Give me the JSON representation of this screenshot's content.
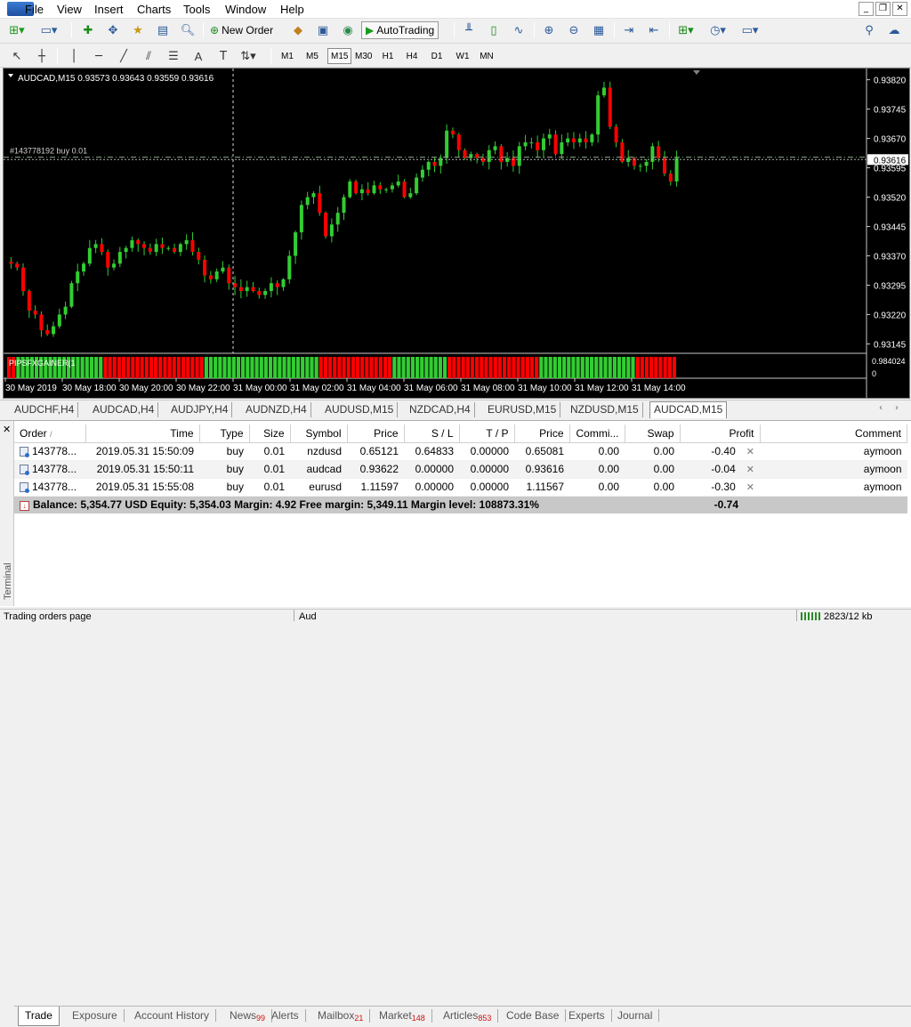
{
  "menu": [
    "File",
    "View",
    "Insert",
    "Charts",
    "Tools",
    "Window",
    "Help"
  ],
  "toolbar": {
    "new_order": "New Order",
    "autotrading": "AutoTrading",
    "timeframes": [
      "M1",
      "M5",
      "M15",
      "M30",
      "H1",
      "H4",
      "D1",
      "W1",
      "MN"
    ],
    "active_timeframe": "M15"
  },
  "chart": {
    "header": "AUDCAD,M15  0.93573 0.93643 0.93559 0.93616",
    "order_line_label": "#143778192 buy 0.01",
    "current_price_label": "0.93616",
    "indicator_label": "PIPSFXGAINER(1",
    "indicator_scale_top": "0.984024",
    "indicator_scale_bottom": "0",
    "bg_color": "#000000",
    "bull_color": "#32cd32",
    "bear_color": "#ff0000",
    "price_axis_labels": [
      "0.93820",
      "0.93745",
      "0.93670",
      "0.93595",
      "0.93520",
      "0.93445",
      "0.93370",
      "0.93295",
      "0.93220",
      "0.93145"
    ],
    "time_axis_labels": [
      "30 May 2019",
      "30 May 18:00",
      "30 May 20:00",
      "30 May 22:00",
      "31 May 00:00",
      "31 May 02:00",
      "31 May 04:00",
      "31 May 06:00",
      "31 May 08:00",
      "31 May 10:00",
      "31 May 12:00",
      "31 May 14:00"
    ]
  },
  "chart_data": {
    "type": "candlestick",
    "symbol": "AUDCAD",
    "timeframe": "M15",
    "ylim": [
      0.9313,
      0.93835
    ],
    "grid": false,
    "candles_close": [
      0.9335,
      0.9334,
      0.9328,
      0.9323,
      0.9322,
      0.9318,
      0.9317,
      0.9319,
      0.9322,
      0.9324,
      0.933,
      0.9333,
      0.9335,
      0.9339,
      0.934,
      0.9338,
      0.9334,
      0.9335,
      0.9338,
      0.9339,
      0.9341,
      0.934,
      0.9339,
      0.9338,
      0.934,
      0.9339,
      0.9339,
      0.9338,
      0.934,
      0.9341,
      0.9338,
      0.9336,
      0.9332,
      0.9331,
      0.9333,
      0.9334,
      0.933,
      0.9329,
      0.9328,
      0.9329,
      0.9328,
      0.9327,
      0.9328,
      0.933,
      0.9329,
      0.9331,
      0.9337,
      0.9343,
      0.935,
      0.9352,
      0.9353,
      0.9348,
      0.9342,
      0.9345,
      0.9348,
      0.9352,
      0.9356,
      0.9353,
      0.9354,
      0.9353,
      0.9355,
      0.9354,
      0.9354,
      0.9355,
      0.9356,
      0.9352,
      0.9353,
      0.9357,
      0.9359,
      0.9361,
      0.936,
      0.9362,
      0.9369,
      0.9368,
      0.9364,
      0.9362,
      0.9363,
      0.9362,
      0.9361,
      0.9364,
      0.9365,
      0.9361,
      0.9362,
      0.936,
      0.9365,
      0.9366,
      0.9366,
      0.9364,
      0.9367,
      0.9368,
      0.9363,
      0.9366,
      0.9367,
      0.9366,
      0.9367,
      0.9366,
      0.9368,
      0.9378,
      0.938,
      0.937,
      0.9366,
      0.9361,
      0.9362,
      0.936,
      0.936,
      0.9361,
      0.9365,
      0.9362,
      0.9358,
      0.9356,
      0.9362
    ],
    "indicator_colors": "R,R,G,G,G,G,G,G,G,G,G,G,G,G,G,G,G,G,G,G,G,R,R,R,R,R,R,R,R,R,R,R,R,R,R,R,R,R,R,R,R,R,R,G,G,G,G,G,G,G,G,G,G,G,G,G,G,G,G,G,G,G,G,G,G,G,G,G,R,R,R,R,R,R,R,R,R,R,R,R,R,R,R,R,G,G,G,G,G,G,G,G,G,G,G,G,R,R,R,R,R,R,R,R,R,R,R,R,R,R,R,R,R,R,R,R,G,G,G,G,G,G,G,G,G,G,G,G,G,G,G,G,G,G,G,G,G,R,R,R,R,R,R,R,R,R"
  },
  "chart_tabs": [
    "AUDCHF,H4",
    "AUDCAD,H4",
    "AUDJPY,H4",
    "AUDNZD,H4",
    "AUDUSD,M15",
    "NZDCAD,H4",
    "EURUSD,M15",
    "NZDUSD,M15",
    "AUDCAD,M15"
  ],
  "active_chart_tab": "AUDCAD,M15",
  "terminal": {
    "side_label": "Terminal",
    "columns": [
      "Order",
      "Time",
      "Type",
      "Size",
      "Symbol",
      "Price",
      "S / L",
      "T / P",
      "Price",
      "Commi...",
      "Swap",
      "Profit",
      "Comment"
    ],
    "rows": [
      [
        "143778...",
        "2019.05.31 15:50:09",
        "buy",
        "0.01",
        "nzdusd",
        "0.65121",
        "0.64833",
        "0.00000",
        "0.65081",
        "0.00",
        "0.00",
        "-0.40",
        "aymoon"
      ],
      [
        "143778...",
        "2019.05.31 15:50:11",
        "buy",
        "0.01",
        "audcad",
        "0.93622",
        "0.00000",
        "0.00000",
        "0.93616",
        "0.00",
        "0.00",
        "-0.04",
        "aymoon"
      ],
      [
        "143778...",
        "2019.05.31 15:55:08",
        "buy",
        "0.01",
        "eurusd",
        "1.11597",
        "0.00000",
        "0.00000",
        "1.11567",
        "0.00",
        "0.00",
        "-0.30",
        "aymoon"
      ]
    ],
    "summary": "Balance: 5,354.77 USD  Equity: 5,354.03  Margin: 4.92  Free margin: 5,349.11  Margin level: 108873.31%",
    "summary_profit": "-0.74",
    "tabs": [
      {
        "label": "Trade",
        "badge": ""
      },
      {
        "label": "Exposure",
        "badge": ""
      },
      {
        "label": "Account History",
        "badge": ""
      },
      {
        "label": "News",
        "badge": "99"
      },
      {
        "label": "Alerts",
        "badge": ""
      },
      {
        "label": "Mailbox",
        "badge": "21"
      },
      {
        "label": "Market",
        "badge": "148"
      },
      {
        "label": "Articles",
        "badge": "853"
      },
      {
        "label": "Code Base",
        "badge": ""
      },
      {
        "label": "Experts",
        "badge": ""
      },
      {
        "label": "Journal",
        "badge": ""
      }
    ],
    "active_tab": "Trade"
  },
  "status": {
    "left": "Trading orders page",
    "mid": "Aud",
    "right": "2823/12 kb"
  }
}
